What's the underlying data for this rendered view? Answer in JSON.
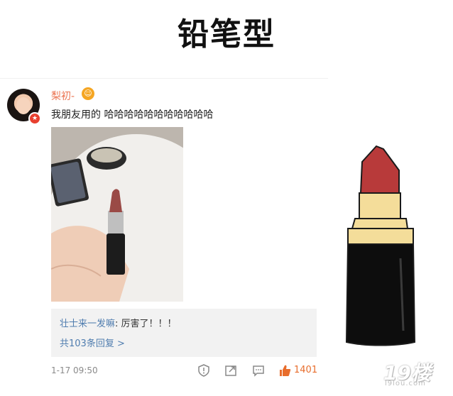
{
  "heading": "铅笔型",
  "post": {
    "username": "梨初-",
    "text": "我朋友用的 哈哈哈哈哈哈哈哈哈哈哈",
    "comment": {
      "author": "壮士来一发嘛",
      "separator": ": ",
      "text": "厉害了！！！"
    },
    "replies_link": "共103条回复 >",
    "timestamp": "1-17 09:50",
    "like_count": "1401",
    "icons": [
      "report-icon",
      "share-icon",
      "comment-icon",
      "like-icon"
    ]
  },
  "watermark": {
    "main": "19楼",
    "sub": "l9lou.com"
  },
  "colors": {
    "username": "#eb7350",
    "link": "#507daf",
    "like": "#e86d2c",
    "lipstick_red": "#b83a3a",
    "lipstick_gold": "#f4dd9a"
  }
}
